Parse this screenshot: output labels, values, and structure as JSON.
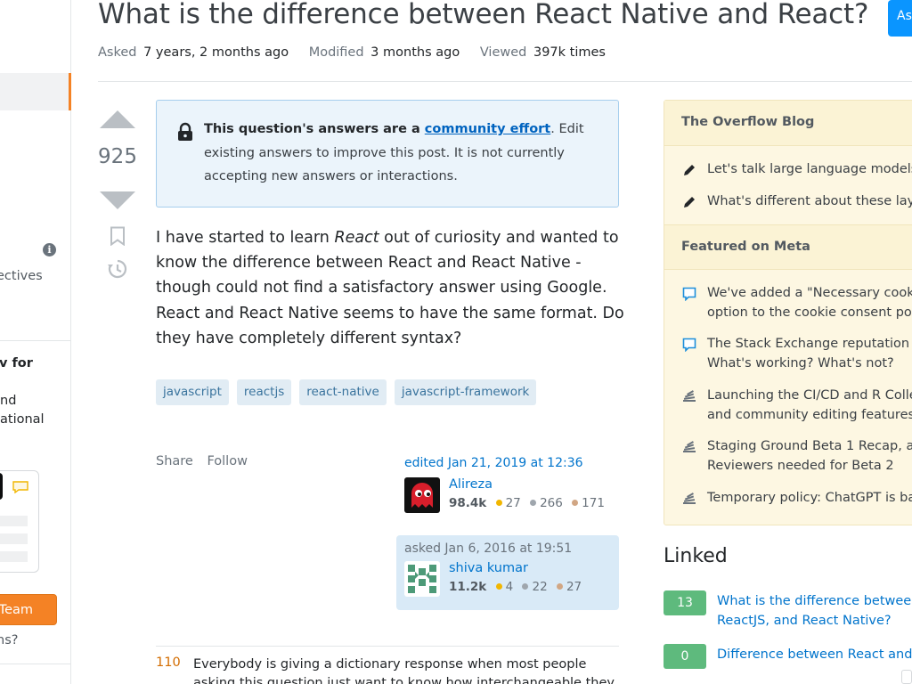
{
  "question": {
    "title": "What is the difference between React Native and React?",
    "meta": {
      "asked_label": "Asked",
      "asked_value": "7 years, 2 months ago",
      "modified_label": "Modified",
      "modified_value": "3 months ago",
      "viewed_label": "Viewed",
      "viewed_value": "397k times"
    },
    "votes": "925",
    "notice": {
      "bold": "This question's answers are a ",
      "link": "community effort",
      "rest": ". Edit existing answers to improve this post. It is not currently accepting new answers or interactions."
    },
    "body_before": "I have started to learn ",
    "body_em": "React",
    "body_after": " out of curiosity and wanted to know the difference between React and React Native - though could not find a satisfactory answer using Google. React and React Native seems to have the same format. Do they have completely different syntax?",
    "tags": [
      "javascript",
      "reactjs",
      "react-native",
      "javascript-framework"
    ],
    "actions": {
      "share": "Share",
      "follow": "Follow"
    },
    "editor": {
      "edited": "edited Jan 21, 2019 at 12:36",
      "name": "Alireza",
      "rep": "98.4k",
      "gold": "27",
      "silver": "266",
      "bronze": "171"
    },
    "asker": {
      "asked": "asked Jan 6, 2016 at 19:51",
      "name": "shiva kumar",
      "rep": "11.2k",
      "gold": "4",
      "silver": "22",
      "bronze": "27"
    }
  },
  "ask_button": "Ask",
  "answer_preview": {
    "votes": "110",
    "text": "Everybody is giving a dictionary response when most people asking this question just want to know how interchangeable they"
  },
  "left_sidebar": {
    "collectives": "ectives",
    "teams_title": "v for",
    "teams_line1": "nd",
    "teams_line2": "ational",
    "team_button": "Team",
    "why": "ns?"
  },
  "overflow_blog": {
    "title": "The Overflow Blog",
    "items": [
      "Let's talk large language models",
      "What's different about these lay"
    ]
  },
  "featured_meta": {
    "title": "Featured on Meta",
    "items": [
      {
        "icon": "meta-chat-icon",
        "line1": "We've added a \"Necessary cooki",
        "line2": "option to the cookie consent po"
      },
      {
        "icon": "meta-chat-icon",
        "line1": "The Stack Exchange reputation s",
        "line2": "What's working? What's not?"
      },
      {
        "icon": "stackexchange-icon",
        "line1": "Launching the CI/CD and R Colle",
        "line2": "and community editing features"
      },
      {
        "icon": "stackexchange-icon",
        "line1": "Staging Ground Beta 1 Recap, an",
        "line2": "Reviewers needed for Beta 2"
      },
      {
        "icon": "stackexchange-icon",
        "line1": "Temporary policy: ChatGPT is ba",
        "line2": ""
      }
    ]
  },
  "linked": {
    "title": "Linked",
    "items": [
      {
        "score": "13",
        "line1": "What is the difference betweer",
        "line2": "ReactJS, and React Native?"
      },
      {
        "score": "0",
        "line1": "Difference between React and",
        "line2": ""
      }
    ]
  },
  "colors": {
    "accent": "#f48225",
    "link": "#0074cc",
    "answered": "#5eba7d",
    "tag_bg": "#e1ecf4"
  }
}
